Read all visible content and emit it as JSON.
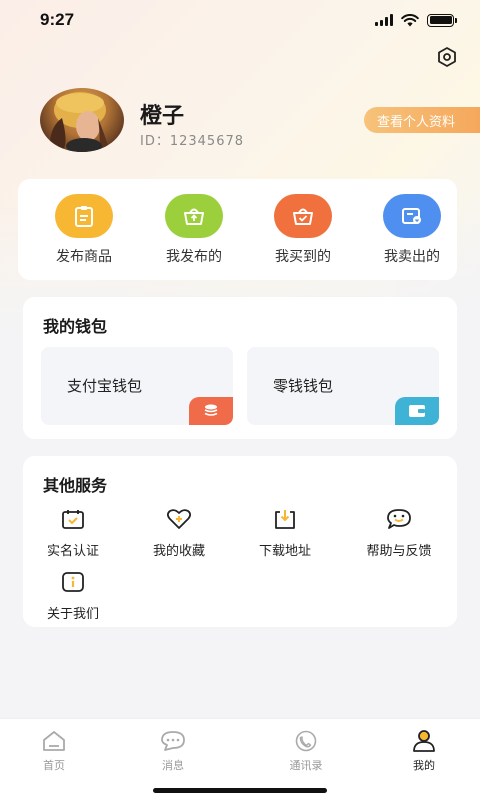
{
  "status_bar": {
    "time": "9:27"
  },
  "profile": {
    "name": "橙子",
    "id_text": "ID：12345678",
    "view_profile_label": "查看个人资料"
  },
  "quick_actions": [
    {
      "label": "发布商品",
      "icon": "clipboard-icon",
      "color": "#f7b733"
    },
    {
      "label": "我发布的",
      "icon": "basket-up-icon",
      "color": "#9ccf3c"
    },
    {
      "label": "我买到的",
      "icon": "basket-check-icon",
      "color": "#f0703e"
    },
    {
      "label": "我卖出的",
      "icon": "wallet-list-icon",
      "color": "#4f8ff0"
    }
  ],
  "wallet": {
    "title": "我的钱包",
    "items": [
      {
        "label": "支付宝钱包",
        "icon": "coin-stack-icon",
        "color": "#f06b4a"
      },
      {
        "label": "零钱钱包",
        "icon": "wallet-icon",
        "color": "#3fb3d6"
      }
    ]
  },
  "services": {
    "title": "其他服务",
    "items": [
      {
        "label": "实名认证",
        "icon": "calendar-check-icon"
      },
      {
        "label": "我的收藏",
        "icon": "heart-plus-icon"
      },
      {
        "label": "下载地址",
        "icon": "download-icon"
      },
      {
        "label": "帮助与反馈",
        "icon": "chat-smile-icon"
      },
      {
        "label": "关于我们",
        "icon": "info-icon"
      }
    ]
  },
  "tab_bar": {
    "items": [
      {
        "label": "首页",
        "icon": "home-icon",
        "active": false
      },
      {
        "label": "消息",
        "icon": "message-icon",
        "active": false
      },
      {
        "label": "通讯录",
        "icon": "phone-book-icon",
        "active": false
      },
      {
        "label": "我的",
        "icon": "user-icon",
        "active": true
      }
    ]
  },
  "colors": {
    "accent": "#f5a85c",
    "service_icon": "#222222",
    "service_icon_accent": "#f7b733"
  }
}
